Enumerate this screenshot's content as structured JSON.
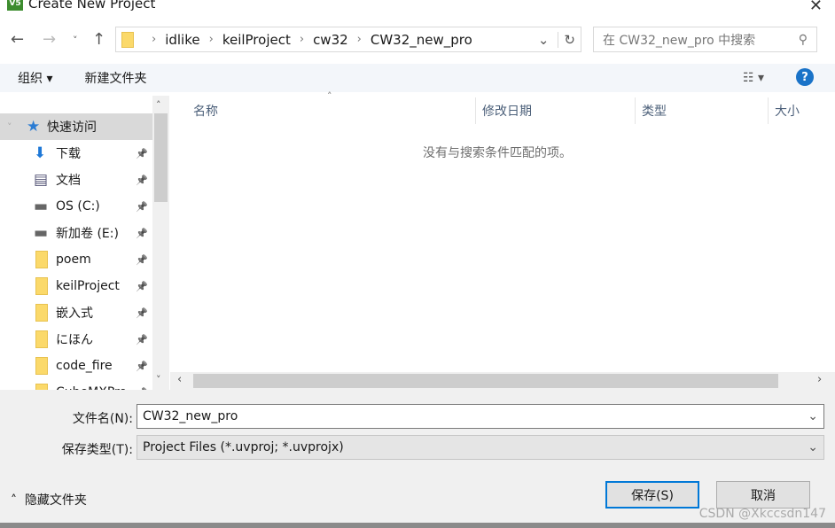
{
  "window": {
    "title": "Create New Project",
    "logo": "V5"
  },
  "address": {
    "path": [
      "idlike",
      "keilProject",
      "cw32",
      "CW32_new_pro"
    ]
  },
  "search": {
    "placeholder": "在 CW32_new_pro 中搜索"
  },
  "toolbar": {
    "organize": "组织",
    "new_folder": "新建文件夹"
  },
  "nav": {
    "items": [
      {
        "label": "快速访问",
        "icon": "star-icon"
      },
      {
        "label": "下载",
        "icon": "download-icon"
      },
      {
        "label": "文档",
        "icon": "document-icon"
      },
      {
        "label": "OS (C:)",
        "icon": "drive-icon"
      },
      {
        "label": "新加卷 (E:)",
        "icon": "drive-icon"
      },
      {
        "label": "poem",
        "icon": "folder-icon"
      },
      {
        "label": "keilProject",
        "icon": "folder-icon"
      },
      {
        "label": "嵌入式",
        "icon": "folder-icon"
      },
      {
        "label": "にほん",
        "icon": "folder-icon"
      },
      {
        "label": "code_fire",
        "icon": "folder-icon"
      },
      {
        "label": "CubeMXPro",
        "icon": "folder-icon"
      }
    ]
  },
  "columns": [
    "名称",
    "修改日期",
    "类型",
    "大小"
  ],
  "empty_message": "没有与搜索条件匹配的项。",
  "form": {
    "filename_label": "文件名(N):",
    "filename_value": "CW32_new_pro",
    "type_label": "保存类型(T):",
    "type_value": "Project Files (*.uvproj; *.uvprojx)"
  },
  "footer": {
    "hide_folders": "隐藏文件夹",
    "save": "保存(S)",
    "cancel": "取消"
  },
  "watermark": "CSDN @Xkccsdn147"
}
